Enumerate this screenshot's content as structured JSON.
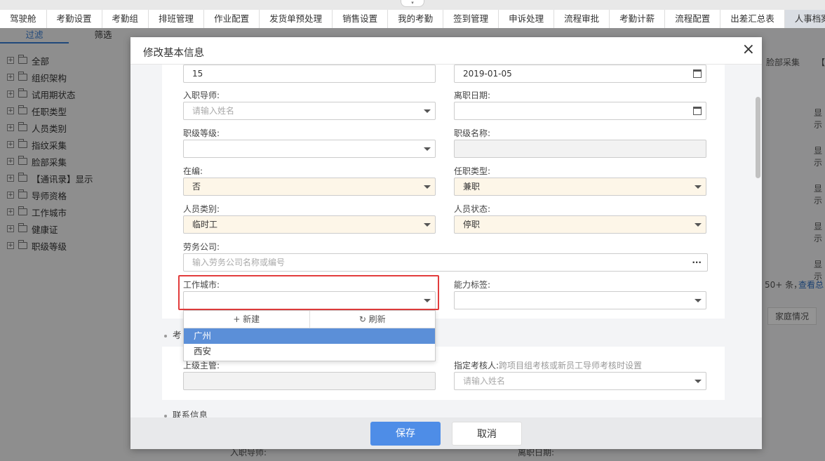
{
  "top_tabs": [
    "驾驶舱",
    "考勤设置",
    "考勤组",
    "排班管理",
    "作业配置",
    "发货单预处理",
    "销售设置",
    "我的考勤",
    "签到管理",
    "申诉处理",
    "流程审批",
    "考勤计薪",
    "流程配置",
    "出差汇总表",
    "人事档案"
  ],
  "sidebar": {
    "filter_tabs": [
      "过滤",
      "筛选"
    ],
    "tree": [
      "全部",
      "组织架构",
      "试用期状态",
      "任职类型",
      "人员类别",
      "指纹采集",
      "脸部采集",
      "【通讯录】显示",
      "导师资格",
      "工作城市",
      "健康证",
      "职级等级"
    ]
  },
  "background": {
    "col_face": "脸部采集",
    "col_bracket": "【",
    "show_text": "显示",
    "count": "50+ 条，",
    "view_total": "查看总",
    "tab_family": "家庭情况",
    "bottom_left_label": "入职导师:",
    "bottom_right_label": "离职日期:"
  },
  "modal": {
    "title": "修改基本信息",
    "close": "×",
    "fields": {
      "top_left_value": "15",
      "top_right_value": "2019-01-05",
      "mentor_label": "入职导师:",
      "mentor_placeholder": "请输入姓名",
      "leave_date_label": "离职日期:",
      "rank_level_label": "职级等级:",
      "rank_name_label": "职级名称:",
      "on_staff_label": "在编:",
      "on_staff_value": "否",
      "employment_type_label": "任职类型:",
      "employment_type_value": "兼职",
      "staff_category_label": "人员类别:",
      "staff_category_value": "临时工",
      "staff_status_label": "人员状态:",
      "staff_status_value": "停职",
      "labor_company_label": "劳务公司:",
      "labor_company_placeholder": "输入劳务公司名称或编号",
      "labor_company_more": "···",
      "work_city_label": "工作城市:",
      "ability_tag_label": "能力标签:",
      "superior_label": "上级主管:",
      "assessor_label": "指定考核人:",
      "assessor_hint": "跨项目组考核或新员工导师考核时设置",
      "assessor_placeholder": "请输入姓名"
    },
    "section_assessment": "考",
    "section_contact": "联系信息",
    "dropdown": {
      "new_label": "+ 新建",
      "refresh_label": "↻ 刷新",
      "options": [
        "广州",
        "西安"
      ],
      "selected": "广州"
    },
    "save_label": "保存",
    "cancel_label": "取消"
  }
}
